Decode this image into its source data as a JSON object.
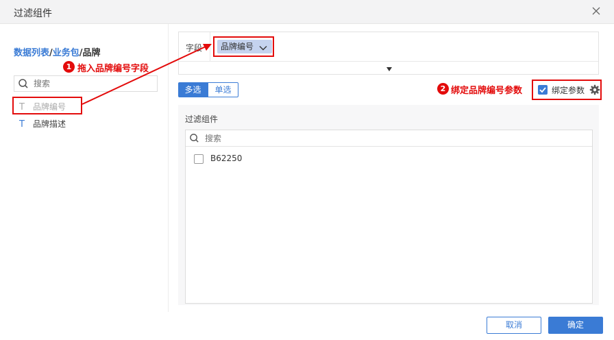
{
  "dialog": {
    "title": "过滤组件",
    "close_icon": "close-icon"
  },
  "left": {
    "breadcrumb": {
      "part1": "数据列表",
      "sep1": "/",
      "part2": "业务包",
      "sep2": "/",
      "part3": "品牌"
    },
    "search_placeholder": "搜索",
    "fields": [
      {
        "type_icon": "T",
        "label": "品牌编号"
      },
      {
        "type_icon": "T",
        "label": "品牌描述"
      }
    ]
  },
  "right": {
    "field_label": "字段",
    "chip_label": "品牌编号",
    "mode": {
      "multi": "多选",
      "single": "单选",
      "selected": "多选"
    },
    "bind_param": {
      "label": "绑定参数",
      "checked": true
    },
    "component": {
      "title": "过滤组件",
      "search_placeholder": "搜索",
      "options": [
        {
          "label": "B62250",
          "checked": false
        }
      ]
    }
  },
  "footer": {
    "cancel": "取消",
    "ok": "确定"
  },
  "annotations": {
    "step1": {
      "num": "1",
      "text": "拖入品牌编号字段"
    },
    "step2": {
      "num": "2",
      "text": "绑定品牌编号参数"
    }
  },
  "colors": {
    "accent": "#3a7bd5",
    "annotation": "#e30b0b",
    "chip": "#c5d3ef"
  }
}
